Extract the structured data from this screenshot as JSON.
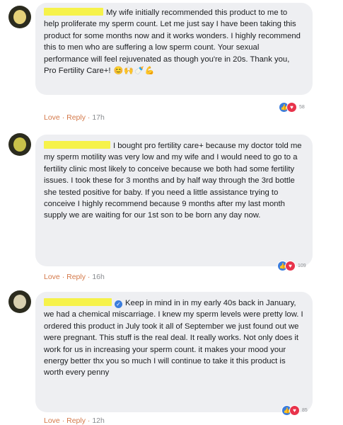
{
  "comments": [
    {
      "text": "My wife initially recommended this product to me to help proliferate my sperm count. Let me just say I have been taking this product for some months now and it works wonders. I highly recommend this to men who are suffering a low sperm count. Your sexual performance will feel rejuvenated as though you're in 20s. Thank you, Pro Fertility Care+!",
      "emojis": [
        "😊",
        "🙌",
        "🍼",
        "💪"
      ],
      "actions": {
        "love": "Love",
        "reply": "Reply",
        "time": "17h"
      },
      "reaction_count": "58"
    },
    {
      "text": "I bought pro fertility care+ because my doctor told me my sperm motility was very low and my wife and I would need to go to a fertility clinic most likely to conceive because we both had some fertility issues. I took these for 3 months and by half way through the 3rd bottle she tested positive for baby. If you need a little assistance trying to conceive I highly recommend because 9 months after my last month supply we are waiting for our 1st son to be born any day now.",
      "actions": {
        "love": "Love",
        "reply": "Reply",
        "time": "16h"
      },
      "reaction_count": "109"
    },
    {
      "text": "Keep in mind in in my early 40s back in January, we had a chemical miscarriage. I knew my sperm levels were pretty low. I ordered this product in July took it all of September we just found out we were pregnant. This stuff is the real deal. It really works. Not only does it work for us in increasing your sperm count. it makes your mood your energy better thx you so much I will continue to take it this product is worth every penny",
      "actions": {
        "love": "Love",
        "reply": "Reply",
        "time": "12h"
      },
      "reaction_count": "85"
    }
  ]
}
